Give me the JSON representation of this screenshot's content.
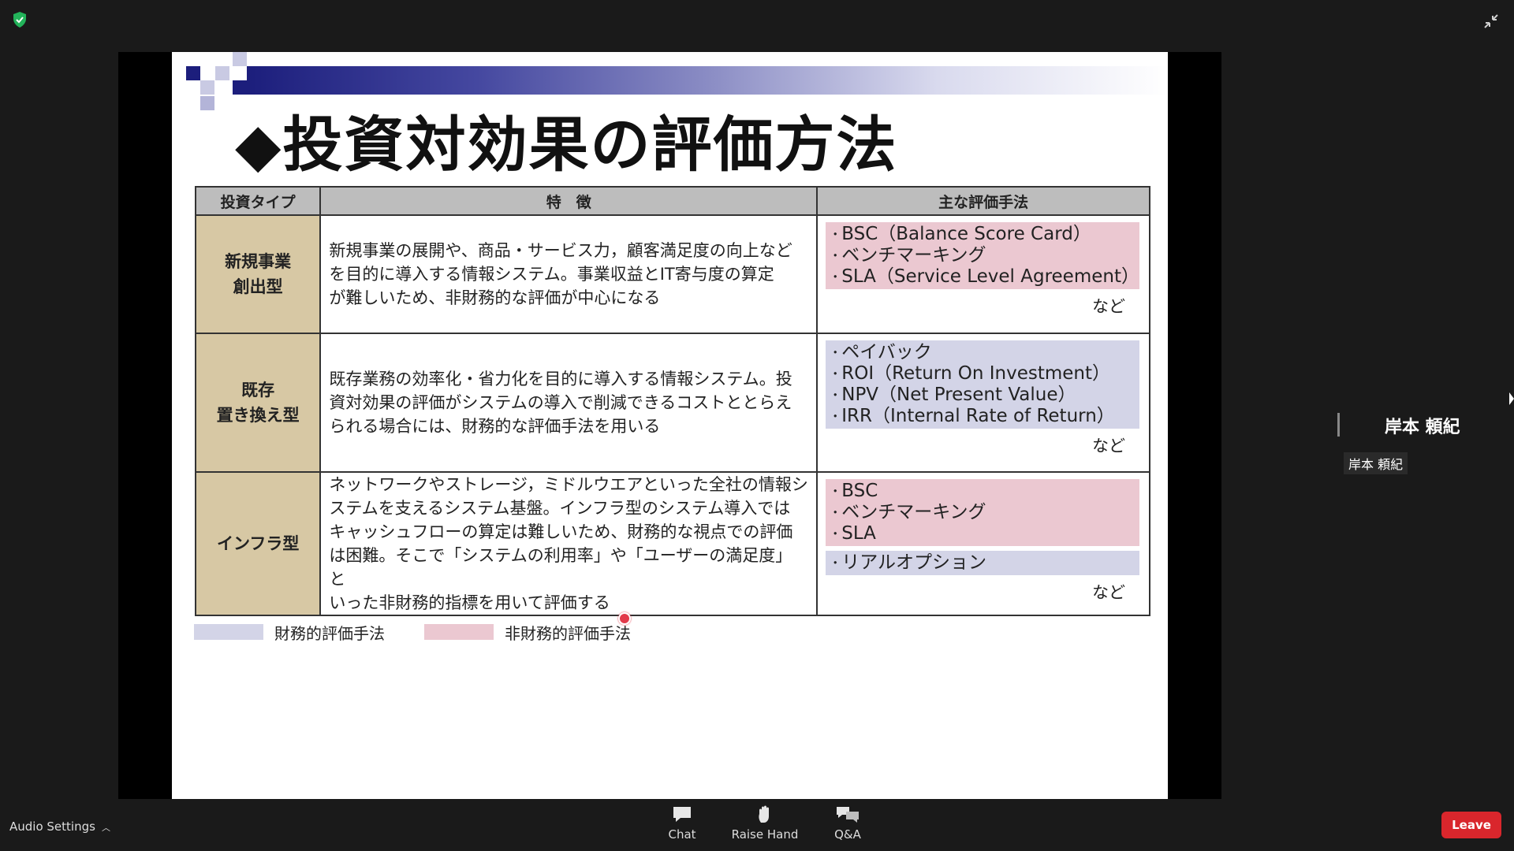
{
  "app": {
    "shield_icon": "shield-check-icon",
    "collapse_icon": "collapse-icon"
  },
  "slide": {
    "title": "◆投資対効果の評価方法",
    "table": {
      "headers": [
        "投資タイプ",
        "特　徴",
        "主な評価手法"
      ],
      "rows": [
        {
          "type_lines": [
            "新規事業",
            "創出型"
          ],
          "feature_lines": [
            "新規事業の展開や、商品・サービス力，顧客満足度の向上など",
            "を目的に導入する情報システム。事業収益とIT寄与度の算定",
            "が難しいため、非財務的な評価が中心になる"
          ],
          "groups": [
            {
              "kind": "non-financial",
              "items": [
                "BSC（Balance Score Card）",
                "ベンチマーキング",
                "SLA（Service Level Agreement）"
              ]
            }
          ],
          "etc": "など"
        },
        {
          "type_lines": [
            "既存",
            "置き換え型"
          ],
          "feature_lines": [
            "既存業務の効率化・省力化を目的に導入する情報システム。投",
            "資対効果の評価がシステムの導入で削減できるコストととらえ",
            "られる場合には、財務的な評価手法を用いる"
          ],
          "groups": [
            {
              "kind": "financial",
              "items": [
                "ペイバック",
                "ROI（Return On Investment）",
                "NPV（Net Present Value）",
                "IRR（Internal Rate of Return）"
              ]
            }
          ],
          "etc": "など"
        },
        {
          "type_lines": [
            "インフラ型"
          ],
          "feature_lines": [
            "ネットワークやストレージ，ミドルウエアといった全社の情報シ",
            "ステムを支えるシステム基盤。インフラ型のシステム導入では",
            "キャッシュフローの算定は難しいため、財務的な視点での評価",
            "は困難。そこで「システムの利用率」や「ユーザーの満足度」と",
            "いった非財務的指標を用いて評価する"
          ],
          "groups": [
            {
              "kind": "non-financial",
              "items": [
                "BSC",
                "ベンチマーキング",
                "SLA"
              ]
            },
            {
              "kind": "financial",
              "items": [
                "リアルオプション"
              ]
            }
          ],
          "etc": "など"
        }
      ]
    },
    "legend": {
      "financial": "財務的評価手法",
      "non_financial": "非財務的評価手法"
    },
    "colors": {
      "financial": "#d3d4e7",
      "non_financial": "#ebc8d1",
      "type_cell": "#d7c8a4",
      "header": "#bdbdbd"
    }
  },
  "speaker": {
    "name": "岸本 頼紀",
    "label": "岸本 頼紀"
  },
  "toolbar": {
    "audio_settings": "Audio Settings",
    "chat": "Chat",
    "raise_hand": "Raise Hand",
    "qa": "Q&A",
    "leave": "Leave"
  }
}
